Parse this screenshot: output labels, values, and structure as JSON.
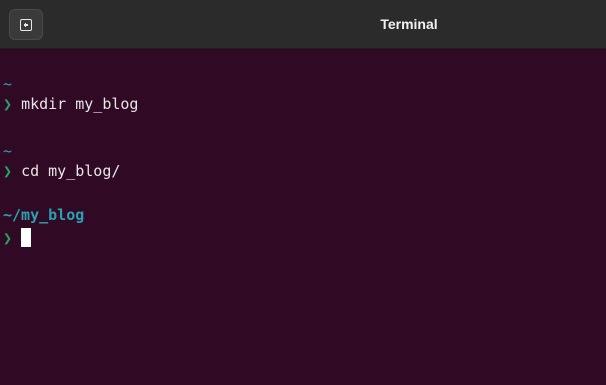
{
  "window": {
    "title": "Terminal"
  },
  "titlebar": {
    "new_tab_icon": "new-tab-icon"
  },
  "terminal": {
    "lines": [
      {
        "path": "~"
      },
      {
        "prompt": "❯",
        "command": "mkdir my_blog"
      },
      {
        "path": "~"
      },
      {
        "prompt": "❯",
        "command": "cd my_blog/"
      },
      {
        "path": "~/my_blog"
      },
      {
        "prompt": "❯",
        "command": ""
      }
    ],
    "colors": {
      "background": "#300a24",
      "path": "#2aa1b3",
      "prompt": "#26a269",
      "text": "#e6e6e6"
    }
  }
}
